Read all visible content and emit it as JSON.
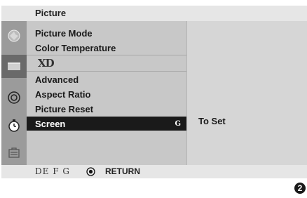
{
  "menu": {
    "title": "Picture",
    "items": [
      {
        "label": "Picture Mode"
      },
      {
        "label": "Color Temperature"
      },
      {
        "label": "XD"
      },
      {
        "label": "Advanced"
      },
      {
        "label": "Aspect Ratio"
      },
      {
        "label": "Picture Reset"
      },
      {
        "label": "Screen",
        "arrow": "G"
      }
    ],
    "selected_index": 6,
    "submenu_text": "To Set"
  },
  "icons": [
    "picture-icon",
    "sound-icon",
    "option-icon",
    "time-icon",
    "lock-icon"
  ],
  "footer": {
    "nav_keys": "DE F G",
    "return_label": "RETURN"
  },
  "badge": "2",
  "colors": {
    "selected_bg": "#1a1a1a",
    "menu_bg": "#c8c8c8",
    "icon_bg": "#9b9b9b",
    "bar_bg": "#e6e6e6"
  }
}
